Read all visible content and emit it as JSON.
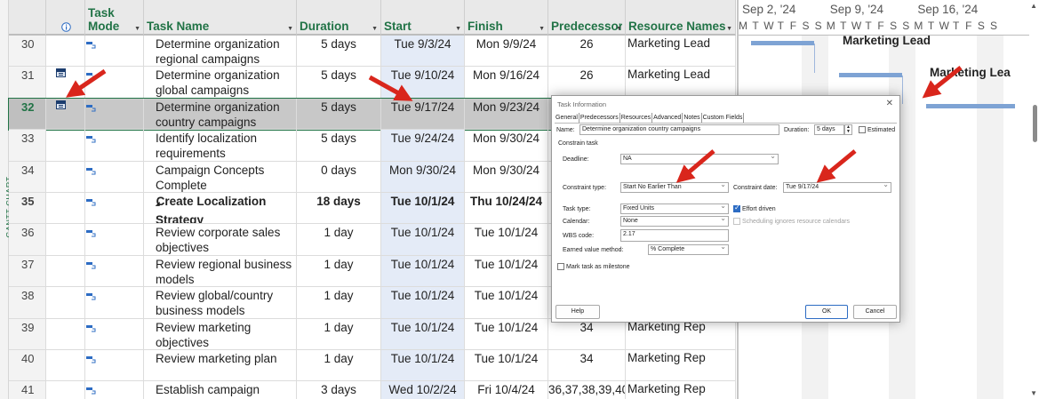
{
  "side_label": "GANTT CHART",
  "columns": {
    "indicators_icon": "info-icon",
    "task_mode": "Task Mode",
    "task_name": "Task Name",
    "duration": "Duration",
    "start": "Start",
    "finish": "Finish",
    "predecessors": "Predecessors",
    "resource_names": "Resource Names"
  },
  "rows": [
    {
      "id": "30",
      "name": "Determine organization regional campaigns",
      "duration": "5 days",
      "start": "Tue 9/3/24",
      "finish": "Mon 9/9/24",
      "pred": "26",
      "res": "Marketing Lead"
    },
    {
      "id": "31",
      "name": "Determine organization global campaigns",
      "duration": "5 days",
      "start": "Tue 9/10/24",
      "finish": "Mon 9/16/24",
      "pred": "26",
      "res": "Marketing Lead"
    },
    {
      "id": "32",
      "name": "Determine organization country campaigns",
      "duration": "5 days",
      "start": "Tue 9/17/24",
      "finish": "Mon 9/23/24",
      "pred": "",
      "res": ""
    },
    {
      "id": "33",
      "name": "Identify localization requirements",
      "duration": "5 days",
      "start": "Tue 9/24/24",
      "finish": "Mon 9/30/24",
      "pred": "",
      "res": ""
    },
    {
      "id": "34",
      "name": "Campaign Concepts Complete",
      "duration": "0 days",
      "start": "Mon 9/30/24",
      "finish": "Mon 9/30/24",
      "pred": "",
      "res": ""
    },
    {
      "id": "35",
      "name": "Create Localization Strategy",
      "duration": "18 days",
      "start": "Tue 10/1/24",
      "finish": "Thu 10/24/24",
      "pred": "",
      "res": ""
    },
    {
      "id": "36",
      "name": "Review corporate sales objectives",
      "duration": "1 day",
      "start": "Tue 10/1/24",
      "finish": "Tue 10/1/24",
      "pred": "",
      "res": ""
    },
    {
      "id": "37",
      "name": "Review regional business models",
      "duration": "1 day",
      "start": "Tue 10/1/24",
      "finish": "Tue 10/1/24",
      "pred": "",
      "res": ""
    },
    {
      "id": "38",
      "name": "Review global/country business models",
      "duration": "1 day",
      "start": "Tue 10/1/24",
      "finish": "Tue 10/1/24",
      "pred": "",
      "res": ""
    },
    {
      "id": "39",
      "name": "Review marketing objectives",
      "duration": "1 day",
      "start": "Tue 10/1/24",
      "finish": "Tue 10/1/24",
      "pred": "34",
      "res": "Marketing Rep"
    },
    {
      "id": "40",
      "name": "Review marketing plan",
      "duration": "1 day",
      "start": "Tue 10/1/24",
      "finish": "Tue 10/1/24",
      "pred": "34",
      "res": "Marketing Rep"
    },
    {
      "id": "41",
      "name": "Establish campaign opportunities",
      "duration": "3 days",
      "start": "Wed 10/2/24",
      "finish": "Fri 10/4/24",
      "pred": "36,37,38,39,40",
      "res": "Marketing Rep"
    }
  ],
  "gantt": {
    "weeks": [
      "Sep 2, '24",
      "Sep 9, '24",
      "Sep 16, '24"
    ],
    "days": [
      "M",
      "T",
      "W",
      "T",
      "F",
      "S",
      "S",
      "M",
      "T",
      "W",
      "T",
      "F",
      "S",
      "S",
      "M",
      "T",
      "W",
      "T",
      "F",
      "S",
      "S"
    ],
    "labels": [
      "Marketing Lead",
      "Marketing Lea"
    ]
  },
  "dialog": {
    "title": "Task Information",
    "tabs": [
      "General",
      "Predecessors",
      "Resources",
      "Advanced",
      "Notes",
      "Custom Fields"
    ],
    "active_tab": "Advanced",
    "name_label": "Name:",
    "name_value": "Determine organization country campaigns",
    "duration_label": "Duration:",
    "duration_value": "5 days",
    "estimated_label": "Estimated",
    "constrain_section": "Constrain task",
    "deadline_label": "Deadline:",
    "deadline_value": "NA",
    "constraint_type_label": "Constraint type:",
    "constraint_type_value": "Start No Earlier Than",
    "constraint_date_label": "Constraint date:",
    "constraint_date_value": "Tue 9/17/24",
    "task_type_label": "Task type:",
    "task_type_value": "Fixed Units",
    "effort_driven_label": "Effort driven",
    "calendar_label": "Calendar:",
    "calendar_value": "None",
    "sched_ignores_label": "Scheduling ignores resource calendars",
    "wbs_label": "WBS code:",
    "wbs_value": "2.17",
    "earned_value_label": "Earned value method:",
    "earned_value_value": "% Complete",
    "milestone_label": "Mark task as milestone",
    "help_button": "Help",
    "ok_button": "OK",
    "cancel_button": "Cancel"
  },
  "colors": {
    "header_text": "#217346",
    "arrow": "#d9261c",
    "gantt_bar": "#7ea3d4",
    "selected_row": "#c8c8c8"
  }
}
